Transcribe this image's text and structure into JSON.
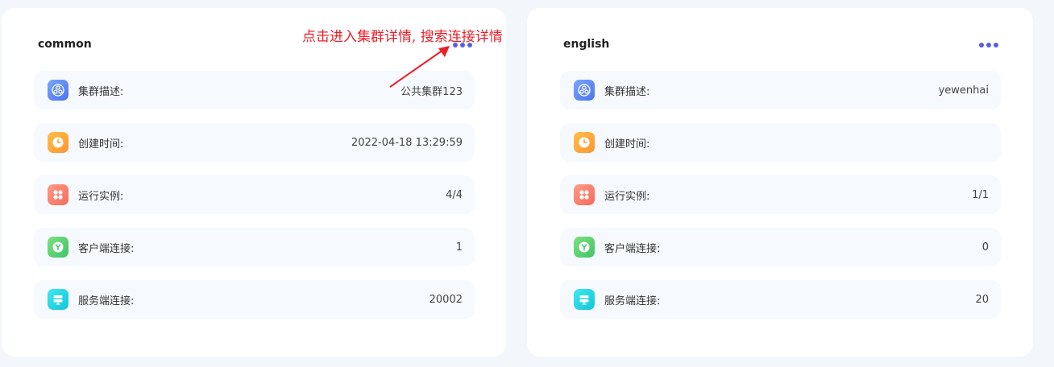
{
  "annotation": {
    "text": "点击进入集群详情, 搜索连接详情",
    "color": "#e8202a"
  },
  "clusters": [
    {
      "title": "common",
      "more_icon": "more-horizontal-icon",
      "rows": [
        {
          "icon": "cluster-icon",
          "label": "集群描述:",
          "value": "公共集群123"
        },
        {
          "icon": "clock-icon",
          "label": "创建时间:",
          "value": "2022-04-18 13:29:59"
        },
        {
          "icon": "apps-icon",
          "label": "运行实例:",
          "value": "4/4"
        },
        {
          "icon": "client-icon",
          "label": "客户端连接:",
          "value": "1"
        },
        {
          "icon": "server-icon",
          "label": "服务端连接:",
          "value": "20002"
        }
      ]
    },
    {
      "title": "english",
      "more_icon": "more-horizontal-icon",
      "rows": [
        {
          "icon": "cluster-icon",
          "label": "集群描述:",
          "value": "yewenhai"
        },
        {
          "icon": "clock-icon",
          "label": "创建时间:",
          "value": ""
        },
        {
          "icon": "apps-icon",
          "label": "运行实例:",
          "value": "1/1"
        },
        {
          "icon": "client-icon",
          "label": "客户端连接:",
          "value": "0"
        },
        {
          "icon": "server-icon",
          "label": "服务端连接:",
          "value": "20"
        }
      ]
    }
  ],
  "colors": {
    "accent": "#5a5ee0",
    "row_background": "#f6f9fe",
    "page_background": "#f3f6fa"
  }
}
